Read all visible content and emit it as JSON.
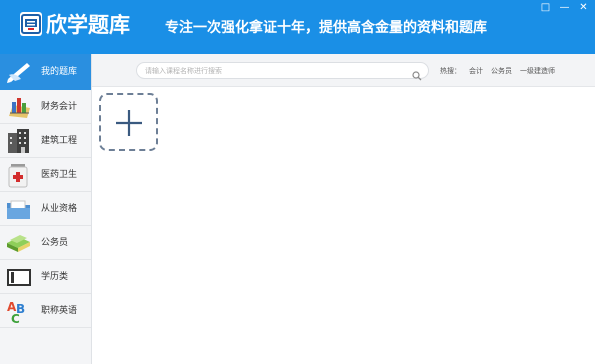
{
  "app": {
    "title": "欣学题库",
    "slogan": "专注一次强化拿证十年，提供高含金量的资料和题库"
  },
  "window_controls": [
    "□",
    "—",
    "✕"
  ],
  "colors": {
    "brand_blue": "#1a8fe6",
    "active_blue": "#2a8fe0",
    "sidebar_bg": "#f4f5f7",
    "tile_border": "#6d7f96"
  },
  "sidebar": {
    "items": [
      {
        "label": "我的题库",
        "icon": "my-library-icon",
        "active": true
      },
      {
        "label": "财务会计",
        "icon": "finance-chart-icon",
        "active": false
      },
      {
        "label": "建筑工程",
        "icon": "building-icon",
        "active": false
      },
      {
        "label": "医药卫生",
        "icon": "medical-kit-icon",
        "active": false
      },
      {
        "label": "从业资格",
        "icon": "folder-icon",
        "active": false
      },
      {
        "label": "公务员",
        "icon": "books-icon",
        "active": false
      },
      {
        "label": "学历类",
        "icon": "book-icon",
        "active": false
      },
      {
        "label": "职称英语",
        "icon": "abc-letters-icon",
        "active": false
      }
    ]
  },
  "search": {
    "placeholder": "请输入课程名称进行搜索",
    "value": ""
  },
  "hot": {
    "label": "热搜：",
    "keywords": [
      "会计",
      "公务员",
      "一级建造师"
    ]
  },
  "main": {
    "add_icon": "plus-icon"
  }
}
